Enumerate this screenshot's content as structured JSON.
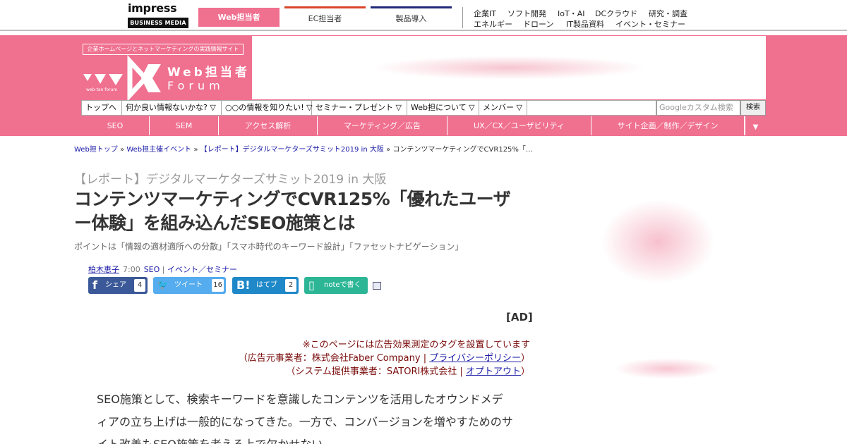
{
  "topbar": {
    "logo_main": "impress",
    "logo_sub": "BUSINESS MEDIA",
    "site_tabs": [
      "Web担当者",
      "EC担当者",
      "製品導入"
    ],
    "links_row1": [
      "企業IT",
      "ソフト開発",
      "IoT・AI",
      "DCクラウド",
      "研究・調査"
    ],
    "links_row2": [
      "エネルギー",
      "ドローン",
      "IT製品資料",
      "イベント・セミナー"
    ]
  },
  "brand": {
    "tagline": "企業ホームページとネットマーケティングの実践情報サイト",
    "name": "Web担当者",
    "forum": "Forum",
    "small": "web-tan forum"
  },
  "dropdown_nav": {
    "items": [
      "トップへ",
      "何か良い情報ないかな? ▽",
      "○○の情報を知りたい! ▽",
      "セミナー・プレゼント ▽",
      "Web担について ▽",
      "メンバー ▽"
    ]
  },
  "search": {
    "placeholder": "Googleカスタム検索",
    "button_label": "検索"
  },
  "category_nav": {
    "items": [
      "SEO",
      "SEM",
      "アクセス解析",
      "マーケティング／広告",
      "UX／CX／ユーザビリティ",
      "サイト企画／制作／デザイン"
    ],
    "more_icon": "▼"
  },
  "breadcrumb": {
    "links": [
      "Web担トップ",
      "Web担主催イベント",
      "【レポート】デジタルマーケターズサミット2019 in 大阪"
    ],
    "separator": "»",
    "current": "コンテンツマーケティングでCVR125%「…"
  },
  "article": {
    "kicker": "【レポート】デジタルマーケターズサミット2019 in 大阪",
    "title": "コンテンツマーケティングでCVR125%「優れたユーザー体験」を組み込んだSEO施策とは",
    "subtitle": "ポイントは「情報の適材適所への分散」「スマホ時代のキーワード設計」「ファセットナビゲーション」",
    "author": "柏木恵子",
    "time": "7:00",
    "categories": [
      "SEO",
      "イベント／セミナー"
    ],
    "category_separator": "|",
    "share": {
      "facebook": {
        "label": "シェア",
        "count": "4",
        "icon": "f"
      },
      "twitter": {
        "label": "ツイート",
        "count": "16",
        "icon": "🐦"
      },
      "hatena": {
        "label": "はてブ",
        "count": "2",
        "icon": "B!"
      },
      "note": {
        "label": "noteで書く",
        "icon": "▯"
      }
    },
    "ad_label": "[AD]",
    "disclosure": {
      "line1": "※このページには広告効果測定のタグを設置しています",
      "line2_prefix": "（広告元事業者：株式会社Faber Company |",
      "line2_link": "プライバシーポリシー",
      "line2_suffix": "）",
      "line3_prefix": "（システム提供事業者：SATORI株式会社 |",
      "line3_link": "オプトアウト",
      "line3_suffix": "）"
    },
    "body": "SEO施策として、検索キーワードを意識したコンテンツを活用したオウンドメディアの立ち上げは一般的になってきた。一方で、コンバージョンを増やすためのサイト改善もSEO施策を考える上で欠かせない。"
  },
  "colors": {
    "brand_pink": "#f07090",
    "link_blue": "#1a1aa6",
    "disclosure_red": "#7a0a0a",
    "facebook": "#3b5998",
    "twitter": "#55acee",
    "hatena": "#1e88c8",
    "note": "#2cb696"
  }
}
